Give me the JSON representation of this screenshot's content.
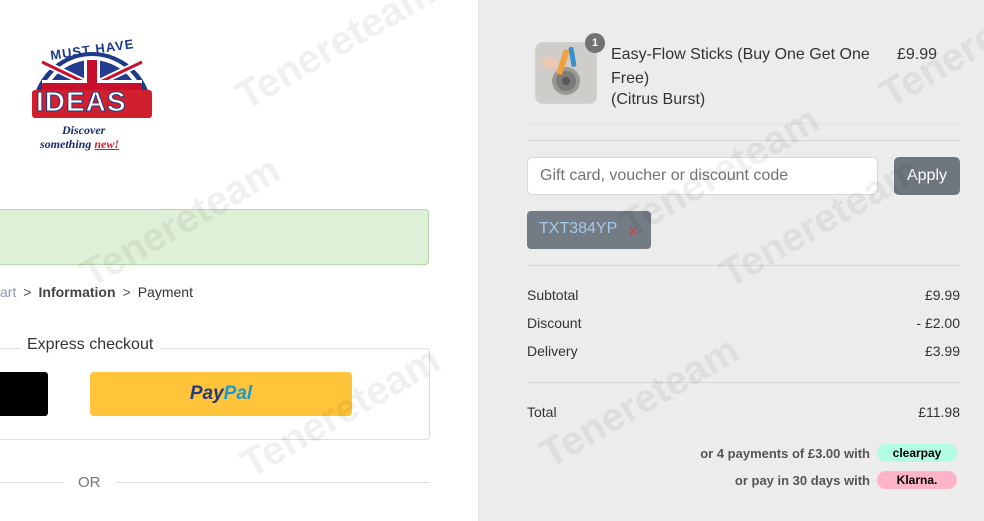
{
  "logo": {
    "text_top": "MUST HAVE",
    "text_main": "IDEAS",
    "tagline_line1": "Discover",
    "tagline_line2_a": "something ",
    "tagline_line2_b": "new!"
  },
  "breadcrumb": {
    "cart": "art",
    "separator": ">",
    "information": "Information",
    "payment": "Payment"
  },
  "express_checkout": {
    "title": "Express checkout",
    "paypal_label_1": "Pay",
    "paypal_label_2": "Pal",
    "or_text": "OR"
  },
  "order": {
    "product": {
      "quantity": "1",
      "name": "Easy-Flow Sticks (Buy One Get One Free)",
      "variant": "(Citrus Burst)",
      "price": "£9.99"
    },
    "discount": {
      "placeholder": "Gift card, voucher or discount code",
      "value": "",
      "apply_label": "Apply",
      "applied_code": "TXT384YP",
      "remove_label": "x"
    },
    "summary": {
      "subtotal_label": "Subtotal",
      "subtotal_value": "£9.99",
      "discount_label": "Discount",
      "discount_value": "- £2.00",
      "delivery_label": "Delivery",
      "delivery_value": "£3.99",
      "total_label": "Total",
      "total_value": "£11.98"
    },
    "payment_options": {
      "clearpay_text": "or 4 payments of £3.00 with",
      "clearpay_brand": "clearpay",
      "klarna_text": "or pay in 30 days with",
      "klarna_brand": "Klarna."
    }
  },
  "colors": {
    "right_panel_bg": "#ececec",
    "apply_button": "#6e7780",
    "paypal_yellow": "#ffc439",
    "notice_green": "#dff0d8",
    "clearpay_mint": "#b2fce4",
    "klarna_pink": "#ffb3c7"
  }
}
